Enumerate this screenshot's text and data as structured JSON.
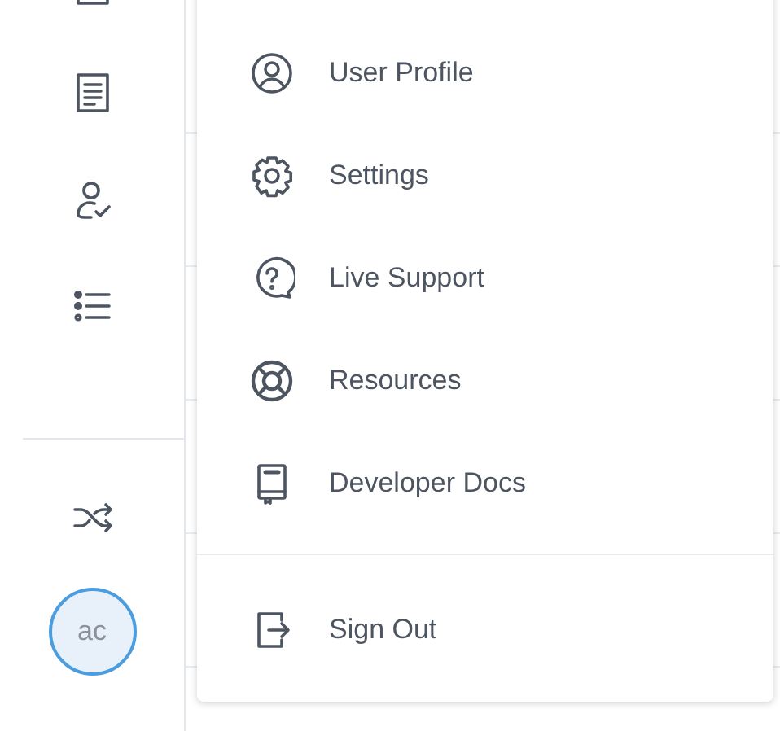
{
  "sidebar": {
    "avatar": {
      "initials": "ac"
    }
  },
  "menu": {
    "items": [
      {
        "label": "User Profile"
      },
      {
        "label": "Settings"
      },
      {
        "label": "Live Support"
      },
      {
        "label": "Resources"
      },
      {
        "label": "Developer Docs"
      }
    ],
    "footer_items": [
      {
        "label": "Sign Out"
      }
    ]
  }
}
